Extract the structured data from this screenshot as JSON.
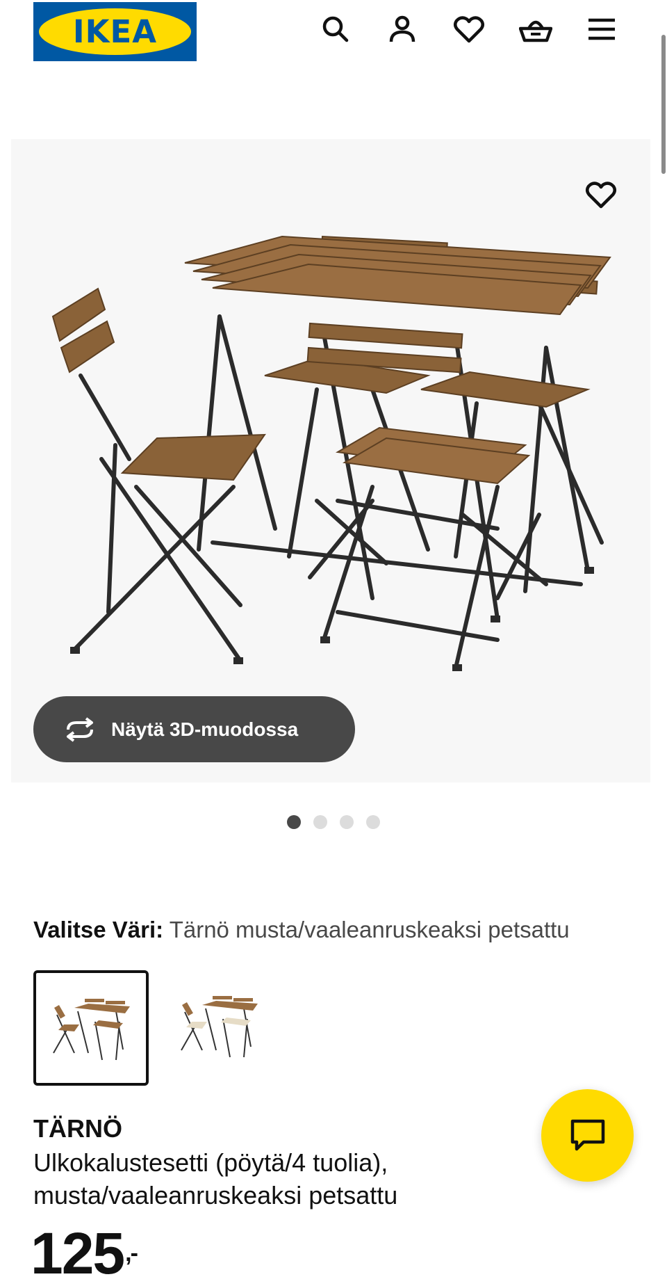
{
  "header": {
    "logo_text": "IKEA",
    "logo_mark": "®",
    "icons": [
      "search-icon",
      "account-icon",
      "heart-icon",
      "basket-icon",
      "menu-icon"
    ]
  },
  "gallery": {
    "image_name": "table-and-four-chairs-photo",
    "view_3d_label": "Näytä 3D-muodossa",
    "slide_count": 4,
    "active_slide": 1
  },
  "color_select": {
    "label": "Valitse Väri:",
    "value": "Tärnö musta/vaaleanruskeaksi petsattu",
    "swatches": [
      "black-frame-brown-slats",
      "black-frame-beige-cushions"
    ]
  },
  "product": {
    "name": "TÄRNÖ",
    "description": "Ulkokalustesetti (pöytä/4 tuolia), musta/vaaleanruskeaksi petsattu",
    "price_integer": "125",
    "price_decimal": ",-"
  },
  "colors": {
    "ikea_blue": "#0058a3",
    "ikea_yellow": "#ffdb00",
    "dark_grey": "#484848"
  }
}
